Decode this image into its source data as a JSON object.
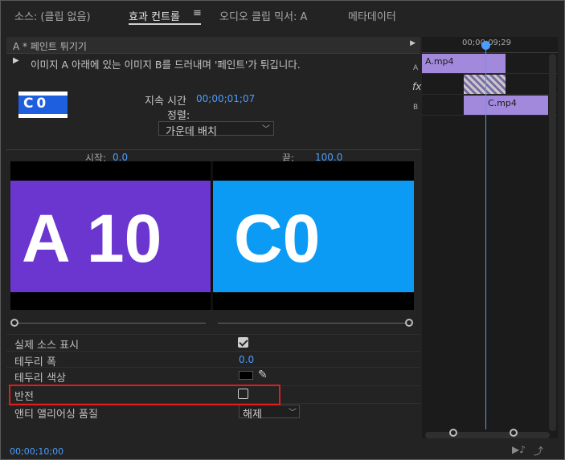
{
  "tabs": [
    {
      "label": "소스: (클립 없음)",
      "active": false
    },
    {
      "label": "효과 컨트롤",
      "active": true
    },
    {
      "label": "오디오 클립 믹서: A",
      "active": false
    },
    {
      "label": "메타데이터",
      "active": false
    }
  ],
  "menu_icon": "≡",
  "effect": {
    "title": "A * 페인트 튀기기",
    "description": "이미지 A 아래에 있는 이미지 B를 드러내며 '페인트'가 튀깁니다.",
    "thumbnail_text": "C 0",
    "duration_label": "지속 시간",
    "duration_value": "00;00;01;07",
    "alignment_label": "정렬:",
    "alignment_value": "가운데 배치",
    "start_label": "시작:",
    "start_value": "0.0",
    "end_label": "끝:",
    "end_value": "100.0",
    "preview_a_text": "A 10",
    "preview_b_text": "C0"
  },
  "properties": [
    {
      "label": "실제 소스 표시",
      "type": "checkbox",
      "checked": true
    },
    {
      "label": "테두리 폭",
      "type": "number",
      "value": "0.0"
    },
    {
      "label": "테두리 색상",
      "type": "color",
      "value": "#000000"
    },
    {
      "label": "반전",
      "type": "checkbox",
      "checked": false
    },
    {
      "label": "앤티 앨리어싱 품질",
      "type": "select",
      "value": "해제"
    }
  ],
  "footer_timecode": "00;00;10;00",
  "timeline": {
    "ruler_timecode": "00;00;09;29",
    "track_a_label": "A",
    "track_b_label": "B",
    "fx_label": "fx",
    "clip_a": "A.mp4",
    "clip_c": "C.mp4"
  },
  "colors": {
    "accent": "#4b9dff",
    "clip": "#a289dc",
    "preview_a_bg": "#6a36cf",
    "preview_b_bg": "#0b9bf4",
    "highlight_box": "#e31b1b"
  }
}
